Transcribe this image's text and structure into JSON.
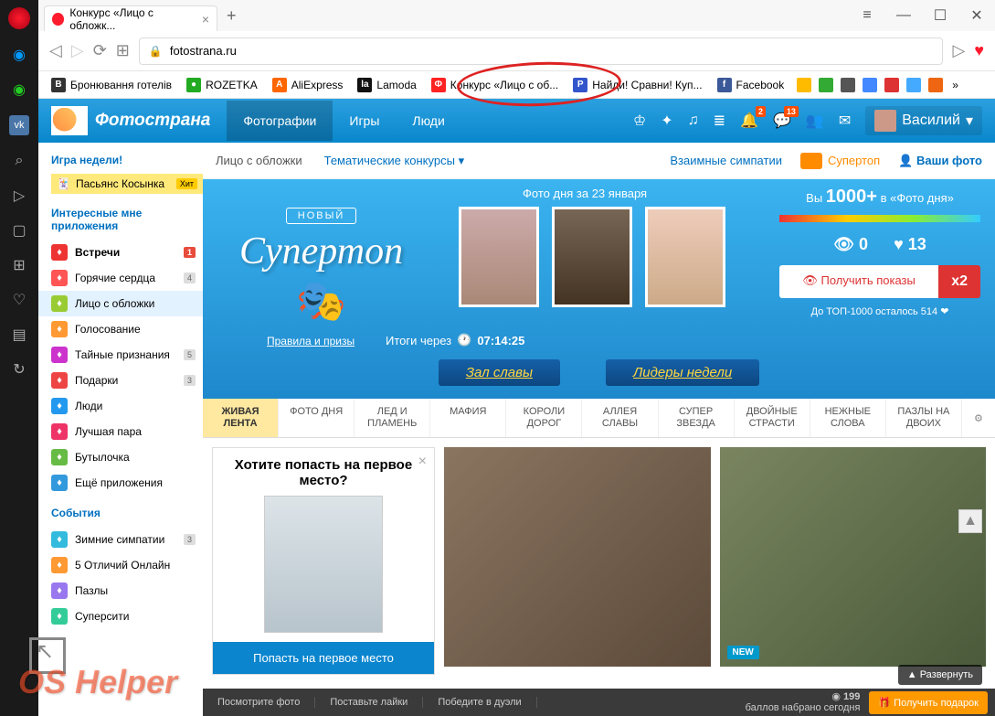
{
  "browser": {
    "tab_title": "Конкурс «Лицо с обложк...",
    "url": "fotostrana.ru"
  },
  "bookmarks": [
    {
      "label": "Бронювання готелів",
      "bg": "#333",
      "ch": "B"
    },
    {
      "label": "ROZETKA",
      "bg": "#2a2",
      "ch": "●"
    },
    {
      "label": "AliExpress",
      "bg": "#f60",
      "ch": "A"
    },
    {
      "label": "Lamoda",
      "bg": "#111",
      "ch": "la"
    },
    {
      "label": "Конкурс «Лицо с об...",
      "bg": "#f22",
      "ch": "Ф"
    },
    {
      "label": "Найди! Сравни! Куп...",
      "bg": "#35c",
      "ch": "P"
    },
    {
      "label": "Facebook",
      "bg": "#3b5998",
      "ch": "f"
    }
  ],
  "site": {
    "name": "Фотострана",
    "nav": [
      "Фотографии",
      "Игры",
      "Люди"
    ],
    "user": "Василий",
    "badge_bell": "2",
    "badge_chat": "13"
  },
  "sidebar": {
    "game_h": "Игра недели!",
    "game_name": "Пасьянс Косынка",
    "hit": "Хит",
    "apps_h": "Интересные мне приложения",
    "apps": [
      {
        "label": "Встречи",
        "count": "1",
        "cred": true,
        "bg": "#e33",
        "bold": true
      },
      {
        "label": "Горячие сердца",
        "count": "4",
        "bg": "#f55"
      },
      {
        "label": "Лицо с обложки",
        "count": "",
        "bg": "#9c3",
        "active": true
      },
      {
        "label": "Голосование",
        "count": "",
        "bg": "#f93"
      },
      {
        "label": "Тайные признания",
        "count": "5",
        "bg": "#c3c"
      },
      {
        "label": "Подарки",
        "count": "3",
        "bg": "#e44"
      },
      {
        "label": "Люди",
        "count": "",
        "bg": "#29e"
      },
      {
        "label": "Лучшая пара",
        "count": "",
        "bg": "#e36"
      },
      {
        "label": "Бутылочка",
        "count": "",
        "bg": "#6b4"
      },
      {
        "label": "Ещё приложения",
        "count": "",
        "bg": "#39d"
      }
    ],
    "events_h": "События",
    "events": [
      {
        "label": "Зимние симпатии",
        "count": "3",
        "bg": "#3bd"
      },
      {
        "label": "5 Отличий Онлайн",
        "count": "",
        "bg": "#f93"
      },
      {
        "label": "Пазлы",
        "count": "",
        "bg": "#97e"
      },
      {
        "label": "Суперсити",
        "count": "",
        "bg": "#3c9"
      }
    ]
  },
  "subnav": {
    "item1": "Лицо с обложки",
    "item2": "Тематические конкурсы",
    "item3": "Взаимные симпатии",
    "item4": "Супертоп",
    "item5": "Ваши фото"
  },
  "hero": {
    "new": "НОВЫЙ",
    "title": "Супертоп",
    "rules": "Правила и призы",
    "photo_day": "Фото дня за 23 января",
    "timer_label": "Итоги через",
    "timer": "07:14:25",
    "you_prefix": "Вы ",
    "you_count": "1000+",
    "you_suffix": " в «Фото дня»",
    "views": "0",
    "likes": "13",
    "get_btn": "Получить показы",
    "x2": "x2",
    "top1000": "До ТОП-1000 осталось 514 ❤",
    "ribbon1": "Зал славы",
    "ribbon2": "Лидеры недели"
  },
  "tabs": [
    "ЖИВАЯ ЛЕНТА",
    "ФОТО ДНЯ",
    "ЛЕД И ПЛАМЕНЬ",
    "МАФИЯ",
    "КОРОЛИ ДОРОГ",
    "АЛЛЕЯ СЛАВЫ",
    "СУПЕР ЗВЕЗДА",
    "ДВОЙНЫЕ СТРАСТИ",
    "НЕЖНЫЕ СЛОВА",
    "ПАЗЛЫ НА ДВОИХ"
  ],
  "promo": {
    "title": "Хотите попасть на первое место?",
    "btn": "Попасть на первое место",
    "new_tag": "NEW"
  },
  "bottom": {
    "i1": "Посмотрите фото",
    "i2": "Поставьте лайки",
    "i3": "Победите в дуэли",
    "points": "199",
    "points_label": "баллов набрано сегодня",
    "expand": "Развернуть",
    "gift": "Получить подарок"
  },
  "watermark": "OS Helper"
}
